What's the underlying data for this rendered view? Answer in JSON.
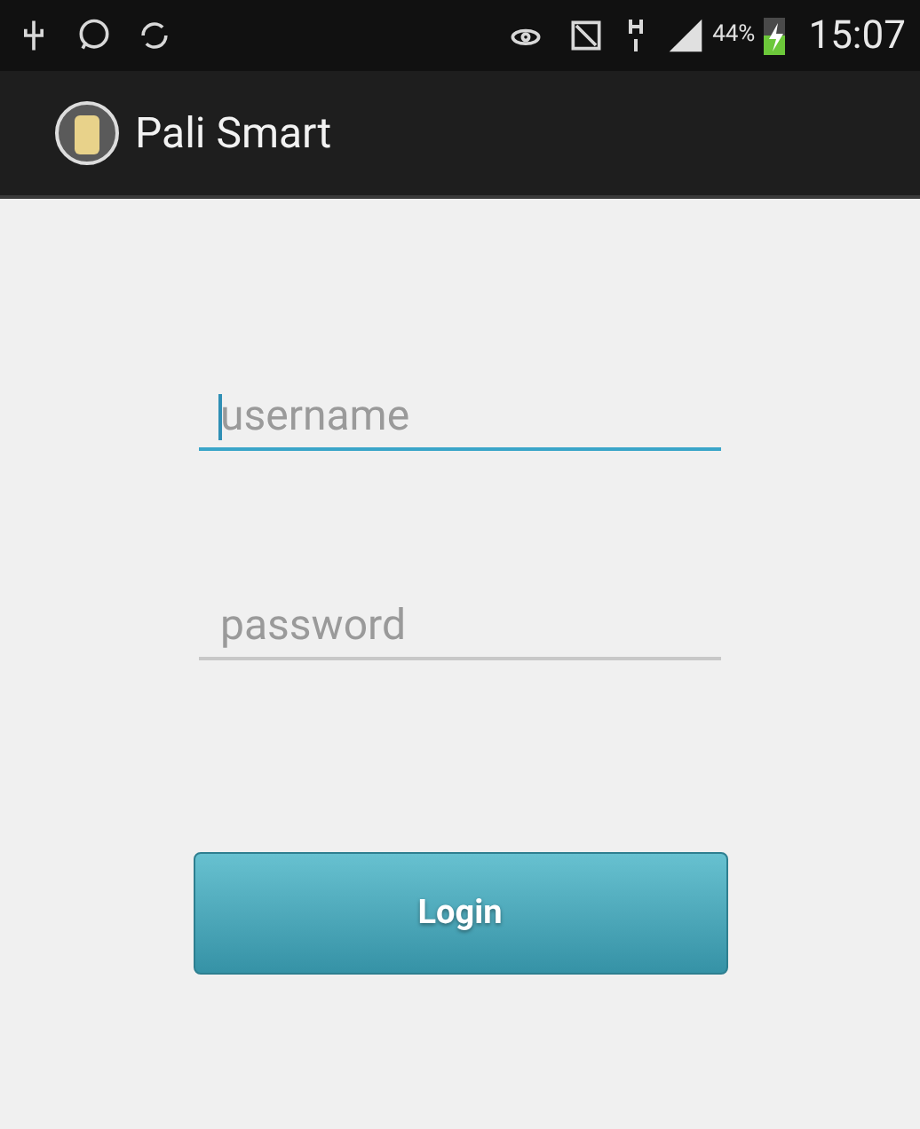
{
  "status_bar": {
    "battery_percent": "44%",
    "time": "15:07"
  },
  "action_bar": {
    "title": "Pali Smart"
  },
  "fields": [
    {
      "placeholder": "username",
      "focused": true
    },
    {
      "placeholder": "password",
      "focused": false
    }
  ],
  "login_button": {
    "label": "Login"
  }
}
